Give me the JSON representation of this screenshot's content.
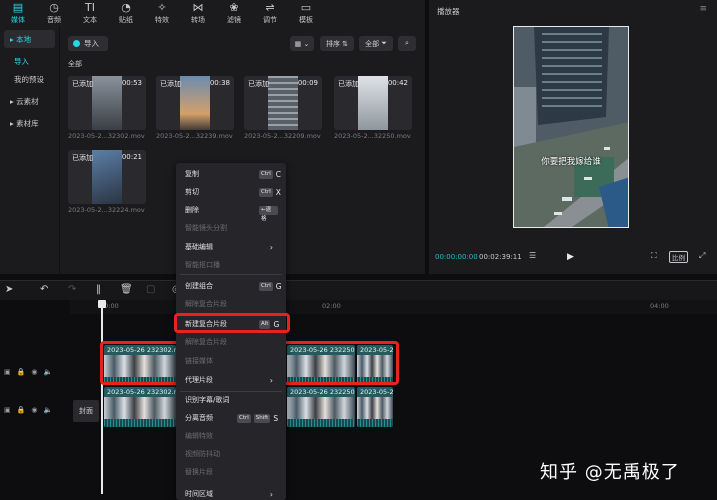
{
  "toolbar": {
    "tools": [
      {
        "label": "媒体",
        "icon": "media-icon",
        "glyph": "▤"
      },
      {
        "label": "音频",
        "icon": "audio-icon",
        "glyph": "◷"
      },
      {
        "label": "文本",
        "icon": "text-icon",
        "glyph": "TI"
      },
      {
        "label": "贴纸",
        "icon": "sticker-icon",
        "glyph": "◔"
      },
      {
        "label": "特效",
        "icon": "effects-icon",
        "glyph": "✧"
      },
      {
        "label": "转场",
        "icon": "transition-icon",
        "glyph": "⋈"
      },
      {
        "label": "滤镜",
        "icon": "filter-icon",
        "glyph": "❀"
      },
      {
        "label": "调节",
        "icon": "adjust-icon",
        "glyph": "⇌"
      },
      {
        "label": "模板",
        "icon": "template-icon",
        "glyph": "▭"
      }
    ]
  },
  "sidebar": {
    "local": "▸ 本地",
    "import": "导入",
    "presets": "我的预设",
    "cloud": "▸ 云素材",
    "library": "▸ 素材库"
  },
  "media": {
    "import_label": "导入",
    "sort_label": "排序",
    "filter_label": "全部",
    "all_label": "全部",
    "clips": [
      {
        "added": "已添加",
        "duration": "00:53",
        "file": "2023-05-2...32302.mov"
      },
      {
        "added": "已添加",
        "duration": "00:38",
        "file": "2023-05-2...32239.mov"
      },
      {
        "added": "已添加",
        "duration": "00:09",
        "file": "2023-05-2...32209.mov"
      },
      {
        "added": "已添加",
        "duration": "00:42",
        "file": "2023-05-2...32250.mov"
      },
      {
        "added": "已添加",
        "duration": "00:21",
        "file": "2023-05-2...32224.mov"
      }
    ]
  },
  "player": {
    "title": "播放器",
    "subtitle": "你要把我嫁给谁",
    "current_time": "00:00:00:00",
    "total_time": "00:02:39:11",
    "ratio_label": "比例"
  },
  "timeline": {
    "ruler": [
      "00:00",
      "02:00",
      "04:00"
    ],
    "clip_name_1": "2023-05-26 232302.mo",
    "clip_name_2": "2023-05-26 232250.mov",
    "clip_name_3": "2023-05-2",
    "cover_label": "封面"
  },
  "context_menu": {
    "items": [
      {
        "label": "复制",
        "keys": [
          "Ctrl",
          "C"
        ],
        "disabled": false
      },
      {
        "label": "剪切",
        "keys": [
          "Ctrl",
          "X"
        ],
        "disabled": false
      },
      {
        "label": "删除",
        "keys": [
          "←退格"
        ],
        "disabled": false
      },
      {
        "label": "智能镜头分割",
        "keys": [],
        "disabled": true
      },
      {
        "label": "基础编辑",
        "keys": [],
        "disabled": false,
        "submenu": true
      },
      {
        "label": "智能抠口播",
        "keys": [],
        "disabled": true
      },
      {
        "label": "创建组合",
        "keys": [
          "Ctrl",
          "G"
        ],
        "disabled": false
      },
      {
        "label": "解除复合片段",
        "keys": [],
        "disabled": true
      },
      {
        "label": "新建复合片段",
        "keys": [
          "Alt",
          "G"
        ],
        "disabled": false,
        "highlight": true
      },
      {
        "label": "解除复合片段",
        "keys": [],
        "disabled": true
      },
      {
        "label": "链接媒体",
        "keys": [],
        "disabled": true
      },
      {
        "label": "代理片段",
        "keys": [],
        "disabled": false,
        "submenu": true
      },
      {
        "label": "识别字幕/歌词",
        "keys": [],
        "disabled": false
      },
      {
        "label": "分离音频",
        "keys": [
          "Ctrl",
          "Shift",
          "S"
        ],
        "disabled": false
      },
      {
        "label": "编辑特效",
        "keys": [],
        "disabled": true
      },
      {
        "label": "视频防抖动",
        "keys": [],
        "disabled": true
      },
      {
        "label": "替换片段",
        "keys": [],
        "disabled": true
      },
      {
        "label": "时间区域",
        "keys": [],
        "disabled": false,
        "submenu": true
      }
    ]
  },
  "watermark": "知乎 @无禹极了",
  "colors": {
    "accent": "#28d7e6",
    "highlight": "#e8231f",
    "panel": "#1b1b1e",
    "clip": "#255b5e"
  }
}
